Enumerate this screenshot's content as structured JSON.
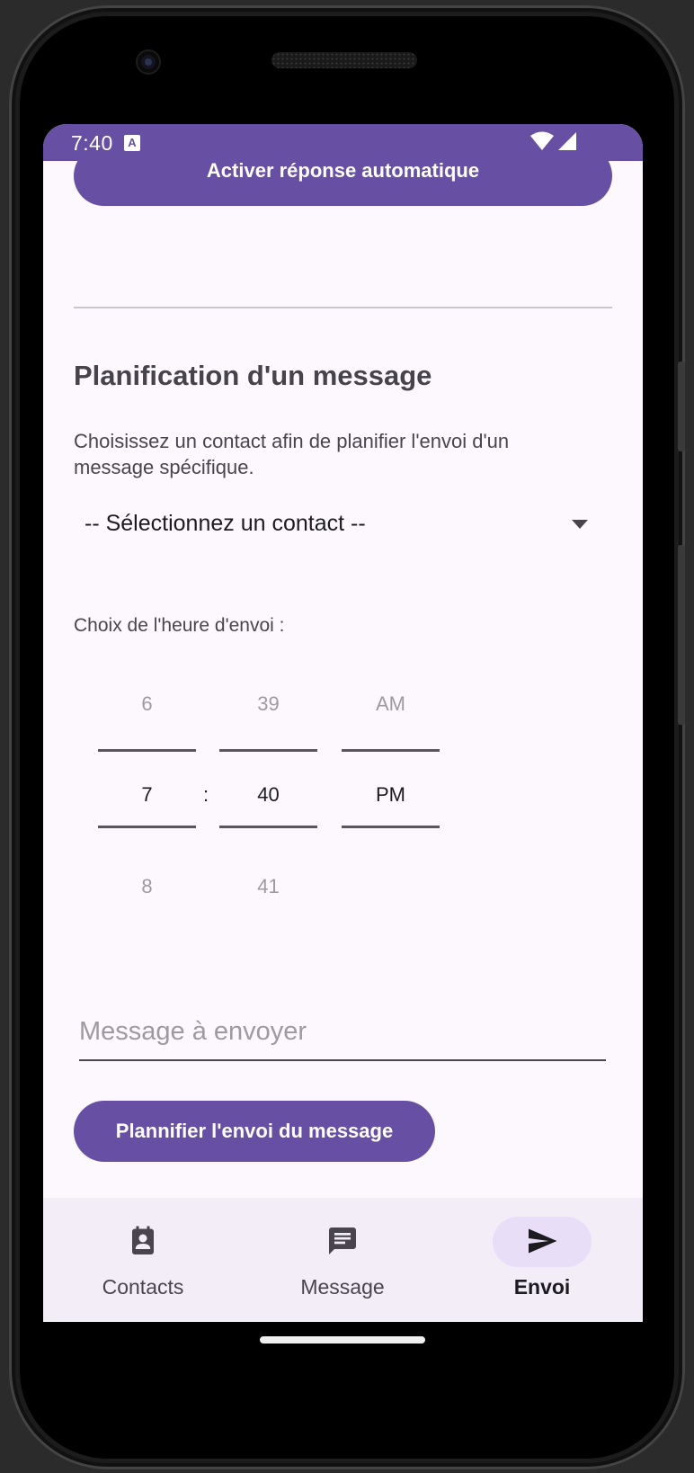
{
  "status_bar": {
    "time": "7:40",
    "notification_icon": "font-a-icon",
    "wifi_icon": "wifi-icon",
    "signal_icon": "cell-signal-icon"
  },
  "auto_reply": {
    "button_label": "Activer réponse automatique"
  },
  "schedule": {
    "title": "Planification d'un message",
    "description": "Choisissez un contact afin de planifier l'envoi d'un message spécifique.",
    "contact_select": {
      "selected": "-- Sélectionnez un contact --"
    },
    "time_label": "Choix de l'heure d'envoi :",
    "time_picker": {
      "hour": {
        "prev": "6",
        "current": "7",
        "next": "8"
      },
      "separator": ":",
      "minute": {
        "prev": "39",
        "current": "40",
        "next": "41"
      },
      "ampm": {
        "prev": "AM",
        "current": "PM",
        "next": ""
      }
    },
    "message_input": {
      "value": "",
      "placeholder": "Message à envoyer"
    },
    "submit_label": "Plannifier l'envoi du message"
  },
  "nav": {
    "items": [
      {
        "label": "Contacts",
        "icon": "contact-card-icon",
        "active": false
      },
      {
        "label": "Message",
        "icon": "message-icon",
        "active": false
      },
      {
        "label": "Envoi",
        "icon": "send-icon",
        "active": true
      }
    ]
  },
  "colors": {
    "primary": "#6750a4",
    "background": "#fdf8fd",
    "nav_background": "#f3edf7",
    "active_indicator": "#e8def8"
  }
}
